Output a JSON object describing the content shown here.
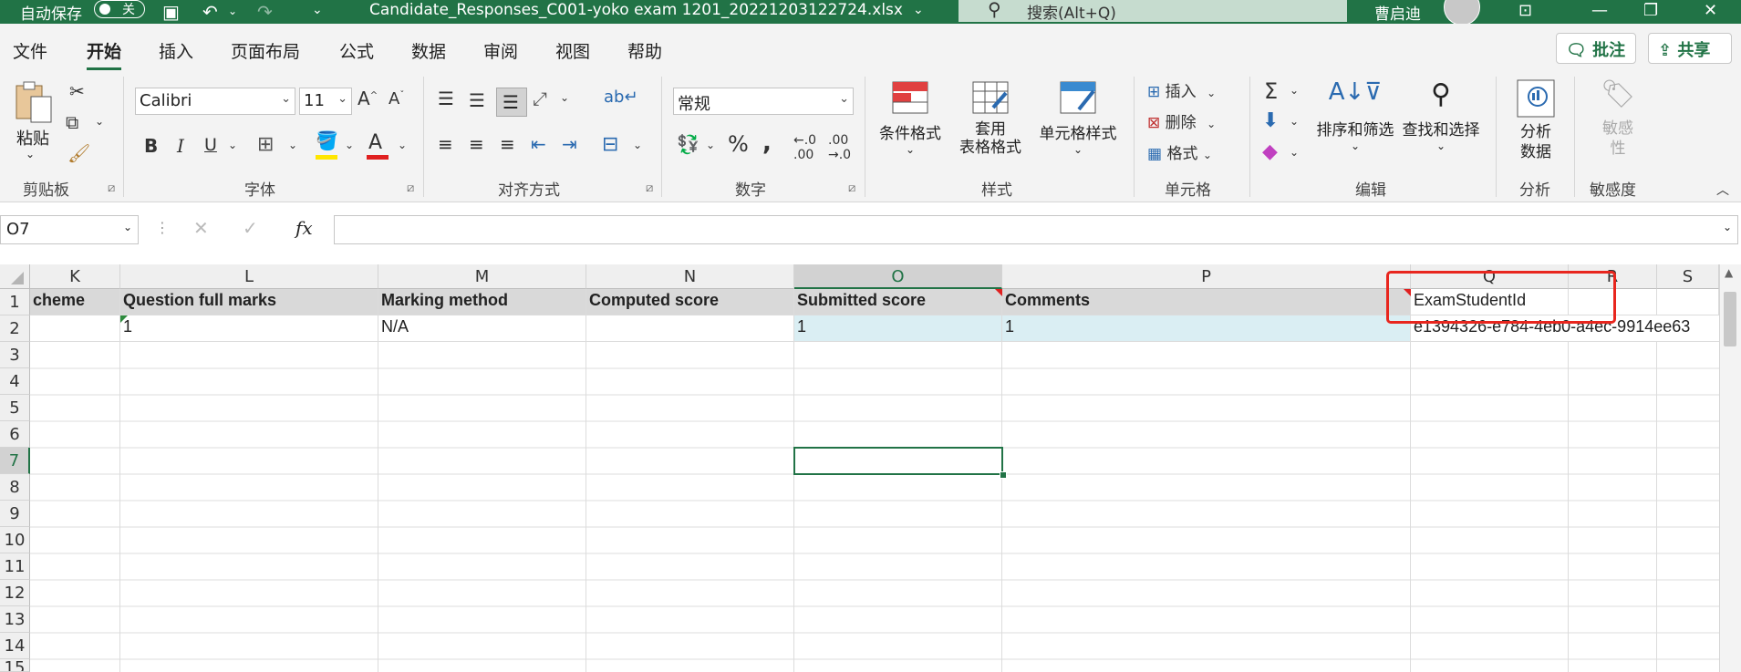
{
  "titlebar": {
    "autosave_label": "自动保存",
    "autosave_state": "关",
    "filename": "Candidate_Responses_C001-yoko exam 1201_20221203122724.xlsx",
    "search_placeholder": "搜索(Alt+Q)",
    "user_name": "曹启迪"
  },
  "menu": {
    "items": [
      "文件",
      "开始",
      "插入",
      "页面布局",
      "公式",
      "数据",
      "审阅",
      "视图",
      "帮助"
    ],
    "active": "开始",
    "comment_button": "批注",
    "share_button": "共享"
  },
  "ribbon": {
    "clipboard": {
      "paste": "粘贴",
      "label": "剪贴板"
    },
    "font": {
      "name": "Calibri",
      "size": "11",
      "label": "字体",
      "bold": "B",
      "italic": "I",
      "underline": "U"
    },
    "alignment": {
      "label": "对齐方式"
    },
    "number": {
      "format": "常规",
      "label": "数字"
    },
    "styles": {
      "conditional": "条件格式",
      "table_format": [
        "套用",
        "表格格式"
      ],
      "cell_styles": "单元格样式",
      "label": "样式"
    },
    "cells": {
      "insert": "插入",
      "delete": "删除",
      "format": "格式",
      "label": "单元格"
    },
    "editing": {
      "sort_filter": "排序和筛选",
      "find_select": "查找和选择",
      "label": "编辑"
    },
    "analysis": {
      "analyze": [
        "分析",
        "数据"
      ],
      "label": "分析"
    },
    "sensitivity": {
      "button": [
        "敏感",
        "性"
      ],
      "label": "敏感度"
    }
  },
  "formula_bar": {
    "name_box": "O7",
    "fx": "fx",
    "value": ""
  },
  "sheet": {
    "columns": [
      "K",
      "L",
      "M",
      "N",
      "O",
      "P",
      "Q",
      "R",
      "S"
    ],
    "selected_column": "O",
    "rows": [
      "1",
      "2",
      "3",
      "4",
      "5",
      "6",
      "7",
      "8",
      "9",
      "10",
      "11",
      "12",
      "13",
      "14",
      "15"
    ],
    "selected_row": "7",
    "header_row": {
      "K": "cheme",
      "L": "Question full marks",
      "M": "Marking method",
      "N": "Computed score",
      "O": "Submitted score",
      "P": "Comments",
      "Q": "ExamStudentId"
    },
    "data_row": {
      "L": "1",
      "M": "N/A",
      "O": "1",
      "P": "1",
      "Q": "e1394326-e784-4eb0-a4ec-9914ee63"
    }
  },
  "colors": {
    "brand": "#217346",
    "highlight_box": "#e8261e",
    "header_fill": "#d9d9d9",
    "selected_fill": "#daeef3"
  }
}
